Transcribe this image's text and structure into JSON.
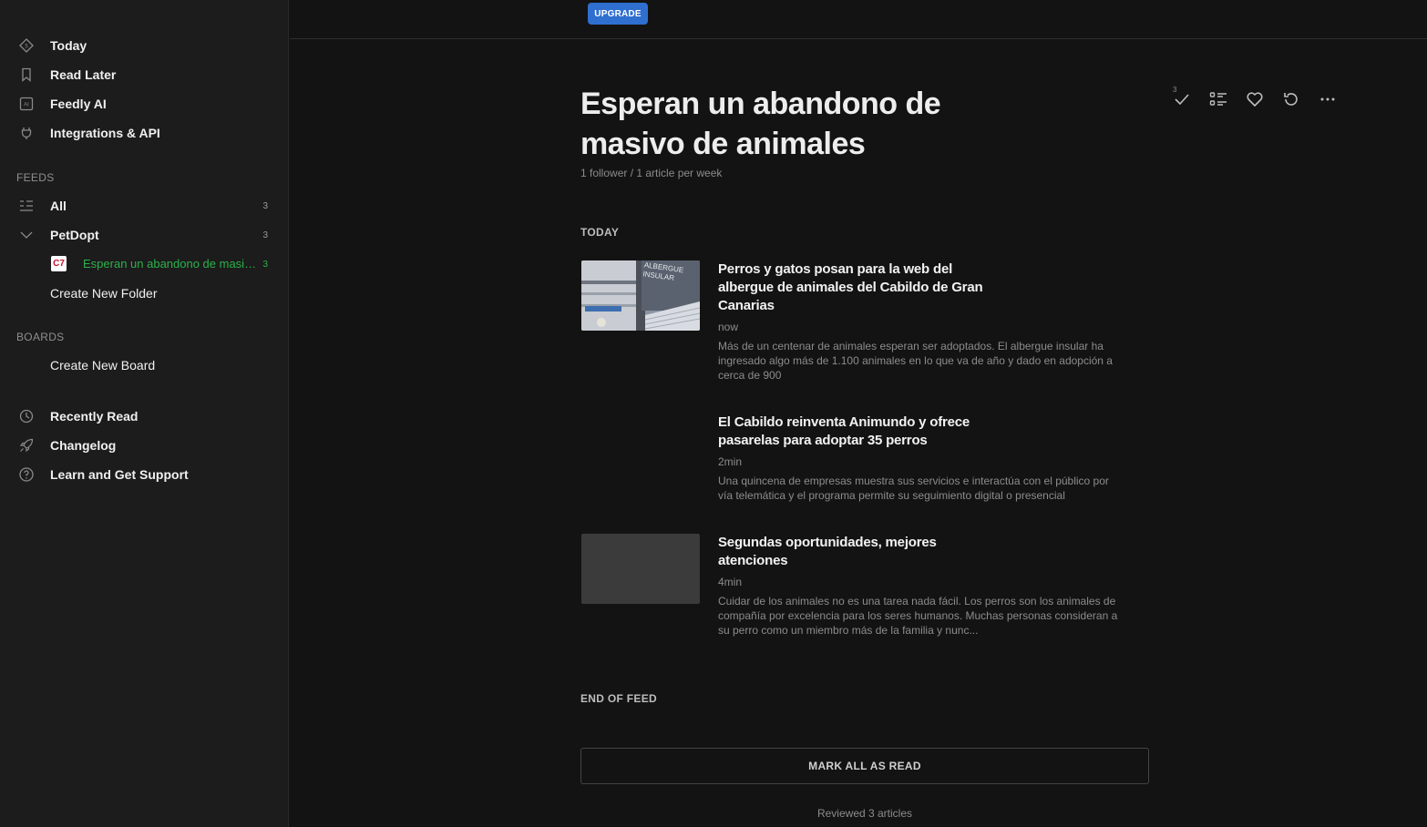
{
  "sidebar": {
    "nav": [
      {
        "label": "Today",
        "icon": "today-icon"
      },
      {
        "label": "Read Later",
        "icon": "bookmark-icon"
      },
      {
        "label": "Feedly AI",
        "icon": "ai-icon"
      },
      {
        "label": "Integrations & API",
        "icon": "plug-icon"
      }
    ],
    "feeds_header": "FEEDS",
    "all": {
      "label": "All",
      "count": "3"
    },
    "folder": {
      "label": "PetDopt",
      "count": "3"
    },
    "feed": {
      "label": "Esperan un abandono de masivo de animales",
      "count": "3",
      "favicon_text": "C7"
    },
    "create_folder": "Create New Folder",
    "boards_header": "BOARDS",
    "create_board": "Create New Board",
    "bottom": [
      {
        "label": "Recently Read",
        "icon": "clock-icon"
      },
      {
        "label": "Changelog",
        "icon": "rocket-icon"
      },
      {
        "label": "Learn and Get Support",
        "icon": "help-icon"
      }
    ]
  },
  "topbar": {
    "upgrade_label": "UPGRADE"
  },
  "main": {
    "title": "Esperan un abandono de masivo de animales",
    "meta": "1 follower / 1 article per week",
    "mark_read_badge": "3",
    "section_today": "TODAY",
    "articles": [
      {
        "title": "Perros y gatos posan para la web del albergue de animales del Cabildo de Gran Canarias",
        "age": "now",
        "summary": "Más de un centenar de animales esperan ser adoptados. El albergue insular ha ingresado algo más de 1.100 animales en lo que va de año y dado en adopción a cerca de 900",
        "thumb_text": "ALBERGUE INSULAR"
      },
      {
        "title": "El Cabildo reinventa Animundo y ofrece pasarelas para adoptar 35 perros",
        "age": "2min",
        "summary": "Una quincena de empresas muestra sus servicios e interactúa con el público por vía telemática y el programa permite su seguimiento digital o presencial"
      },
      {
        "title": "Segundas oportunidades, mejores atenciones",
        "age": "4min",
        "summary": "Cuidar de los animales no es una tarea nada fácil. Los perros son los animales de compañía por excelencia para los seres humanos. Muchas personas consideran a su perro como un miembro más de la familia y nunc..."
      }
    ],
    "end_of_feed": "END OF FEED",
    "mark_all_label": "MARK ALL AS READ",
    "reviewed": "Reviewed 3 articles"
  },
  "colors": {
    "accent_green": "#2bb24c",
    "upgrade_blue": "#2f6fd0",
    "background": "#131313",
    "sidebar_bg": "#1c1c1c"
  }
}
